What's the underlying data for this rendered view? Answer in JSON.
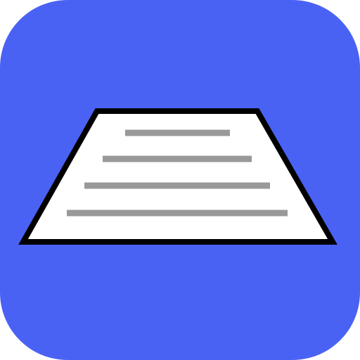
{
  "icon": {
    "name": "document-perspective-icon",
    "colors": {
      "background": "#4a62f3",
      "paper": "#ffffff",
      "outline": "#000000",
      "text_lines": "#999999"
    }
  }
}
